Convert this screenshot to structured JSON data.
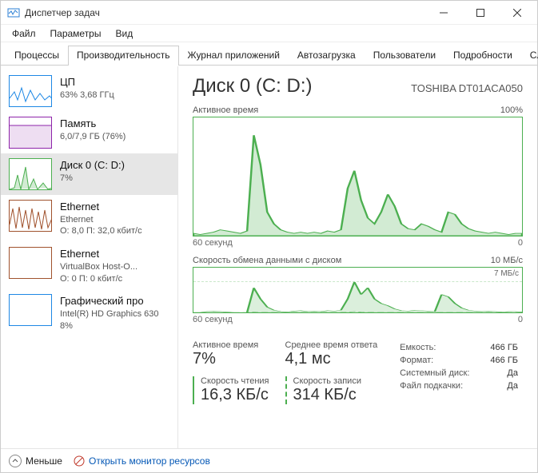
{
  "window": {
    "title": "Диспетчер задач"
  },
  "menu": {
    "file": "Файл",
    "options": "Параметры",
    "view": "Вид"
  },
  "tabs": {
    "processes": "Процессы",
    "performance": "Производительность",
    "app_history": "Журнал приложений",
    "startup": "Автозагрузка",
    "users": "Пользователи",
    "details": "Подробности",
    "services": "Службы"
  },
  "sidebar": {
    "cpu": {
      "title": "ЦП",
      "sub": "63% 3,68 ГГц",
      "color": "#1e88e5"
    },
    "memory": {
      "title": "Память",
      "sub": "6,0/7,9 ГБ (76%)",
      "color": "#8e24aa"
    },
    "disk": {
      "title": "Диск 0 (C: D:)",
      "sub": "7%",
      "color": "#4caf50"
    },
    "eth1": {
      "title": "Ethernet",
      "sub1": "Ethernet",
      "sub2": "О: 8,0 П: 32,0 кбит/с",
      "color": "#a0522d"
    },
    "eth2": {
      "title": "Ethernet",
      "sub1": "VirtualBox Host-O...",
      "sub2": "О: 0 П: 0 кбит/с",
      "color": "#a0522d"
    },
    "gpu": {
      "title": "Графический про",
      "sub1": "Intel(R) HD Graphics 630",
      "sub2": "8%",
      "color": "#1e88e5"
    }
  },
  "disk_view": {
    "title": "Диск 0 (C: D:)",
    "model": "TOSHIBA DT01ACA050",
    "chart1_label": "Активное время",
    "chart1_max": "100%",
    "chart2_label": "Скорость обмена данными с диском",
    "chart2_max": "10 МБ/с",
    "chart2_sublabel": "7 МБ/с",
    "time_axis_left": "60 секунд",
    "time_axis_right": "0",
    "stats": {
      "active_label": "Активное время",
      "active_value": "7%",
      "response_label": "Среднее время ответа",
      "response_value": "4,1 мс",
      "read_label": "Скорость чтения",
      "read_value": "16,3 КБ/с",
      "write_label": "Скорость записи",
      "write_value": "314 КБ/с"
    },
    "props": {
      "capacity_k": "Емкость:",
      "capacity_v": "466 ГБ",
      "formatted_k": "Формат:",
      "formatted_v": "466 ГБ",
      "system_k": "Системный диск:",
      "system_v": "Да",
      "pagefile_k": "Файл подкачки:",
      "pagefile_v": "Да"
    }
  },
  "footer": {
    "fewer": "Меньше",
    "monitor": "Открыть монитор ресурсов"
  },
  "chart_data": [
    {
      "type": "area",
      "title": "Активное время",
      "ylabel": "%",
      "ylim": [
        0,
        100
      ],
      "x_range_seconds": [
        60,
        0
      ],
      "values": [
        2,
        1,
        2,
        3,
        5,
        4,
        3,
        2,
        4,
        85,
        60,
        20,
        10,
        5,
        3,
        2,
        3,
        2,
        3,
        2,
        4,
        3,
        5,
        40,
        55,
        30,
        15,
        10,
        20,
        35,
        25,
        10,
        6,
        5,
        10,
        8,
        5,
        3,
        20,
        18,
        10,
        6,
        4,
        3,
        2,
        3,
        2,
        1,
        2,
        2
      ]
    },
    {
      "type": "area",
      "title": "Скорость обмена данными с диском",
      "ylabel": "МБ/с",
      "ylim": [
        0,
        10
      ],
      "x_range_seconds": [
        60,
        0
      ],
      "series": [
        {
          "name": "write",
          "values": [
            0,
            0,
            0.2,
            0.3,
            0.2,
            0.1,
            0,
            0,
            0,
            5.5,
            3.0,
            1.2,
            0.5,
            0.2,
            0.1,
            0.3,
            0.4,
            0.2,
            0.3,
            0.2,
            0.4,
            0.3,
            0.5,
            3.0,
            6.8,
            4.0,
            5.5,
            3.0,
            2.0,
            1.5,
            0.8,
            0.4,
            0.3,
            0.5,
            0.4,
            0.3,
            0.2,
            4.0,
            3.5,
            2.0,
            1.0,
            0.5,
            0.3,
            0.2,
            0.3,
            0.2,
            0.1,
            0.2,
            0.2,
            0.1
          ]
        },
        {
          "name": "read",
          "values": [
            0,
            0,
            0,
            0,
            0,
            0,
            0,
            0,
            0,
            0.1,
            0.05,
            0.02,
            0.02,
            0.02,
            0.02,
            0.02,
            0.02,
            0.02,
            0.02,
            0.02,
            0.02,
            0.02,
            0.02,
            0.1,
            0.2,
            0.1,
            0.05,
            0.02,
            0.02,
            0.02,
            0.02,
            0.02,
            0.02,
            0.02,
            0.02,
            0.02,
            0.02,
            0.02,
            0.02,
            0.02,
            0.02,
            0.02,
            0.02,
            0.02,
            0.02,
            0.02,
            0.02,
            0.02,
            0.02,
            0.02
          ]
        }
      ]
    }
  ]
}
